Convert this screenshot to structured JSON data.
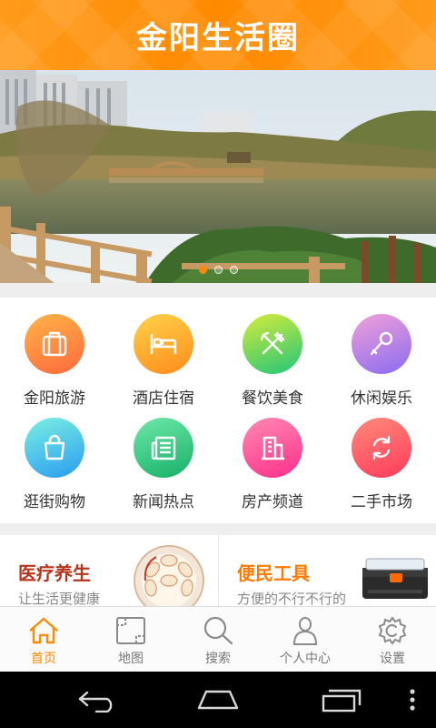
{
  "header": {
    "title": "金阳生活圈"
  },
  "banner": {
    "image_desc": "lake-park-scene",
    "slides": 3,
    "active_slide": 1
  },
  "categories": [
    {
      "label": "金阳旅游",
      "icon": "suitcase-icon",
      "color_top": "#ffb347",
      "color_bottom": "#ff6a3d"
    },
    {
      "label": "酒店住宿",
      "icon": "bed-icon",
      "color_top": "#ffd24a",
      "color_bottom": "#ff8c1a"
    },
    {
      "label": "餐饮美食",
      "icon": "fork-knife-icon",
      "color_top": "#d6ec3a",
      "color_bottom": "#22c57a"
    },
    {
      "label": "休闲娱乐",
      "icon": "microphone-icon",
      "color_top": "#f2a0d8",
      "color_bottom": "#8a6cf0"
    },
    {
      "label": "逛街购物",
      "icon": "shopping-bag-icon",
      "color_top": "#7af0e2",
      "color_bottom": "#2a9cf0"
    },
    {
      "label": "新闻热点",
      "icon": "newspaper-icon",
      "color_top": "#6ee8a8",
      "color_bottom": "#17b068"
    },
    {
      "label": "房产频道",
      "icon": "building-icon",
      "color_top": "#ff8ab4",
      "color_bottom": "#ff2e8a"
    },
    {
      "label": "二手市场",
      "icon": "recycle-icon",
      "color_top": "#ff8a7a",
      "color_bottom": "#ff3b5c"
    }
  ],
  "promos": [
    {
      "title": "医疗养生",
      "subtitle": "让生活更健康",
      "title_color": "#b5341c",
      "image": "dumpling-plate"
    },
    {
      "title": "便民工具",
      "subtitle": "方便的不行不行的",
      "title_color": "#ff7a00",
      "image": "toolbox"
    }
  ],
  "tabs": [
    {
      "label": "首页",
      "icon": "home-icon",
      "active": true
    },
    {
      "label": "地图",
      "icon": "map-icon",
      "active": false
    },
    {
      "label": "搜索",
      "icon": "search-icon",
      "active": false
    },
    {
      "label": "个人中心",
      "icon": "user-icon",
      "active": false
    },
    {
      "label": "设置",
      "icon": "gear-icon",
      "active": false
    }
  ],
  "colors": {
    "accent": "#ff8a00",
    "divider": "#eeeeee"
  }
}
